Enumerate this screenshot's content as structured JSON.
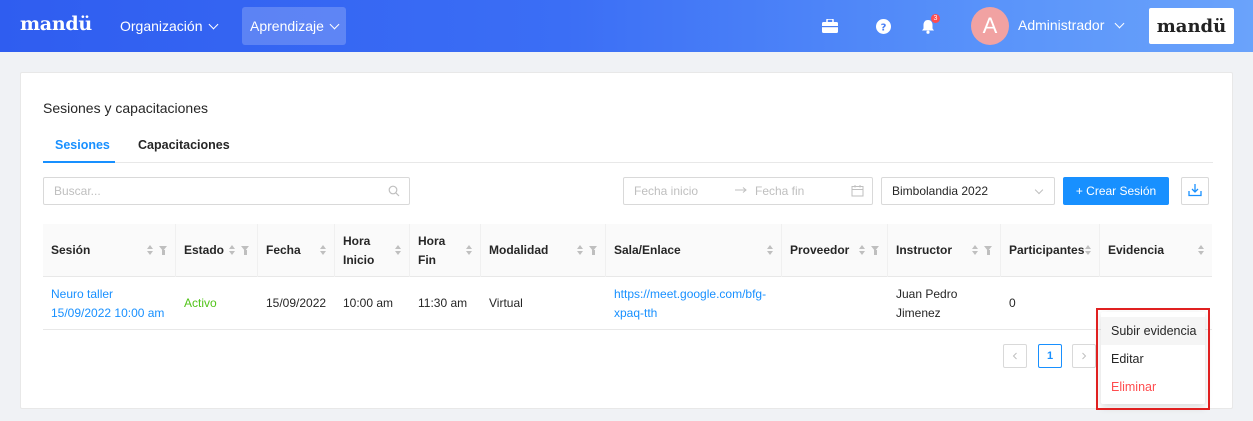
{
  "header": {
    "logo": "mandü",
    "nav": [
      {
        "label": "Organización"
      },
      {
        "label": "Aprendizaje"
      }
    ],
    "notification_count": "3",
    "avatar_letter": "A",
    "user_name": "Administrador",
    "brand": "mandü"
  },
  "page": {
    "title": "Sesiones y capacitaciones",
    "tabs": [
      {
        "label": "Sesiones"
      },
      {
        "label": "Capacitaciones"
      }
    ]
  },
  "filters": {
    "search_placeholder": "Buscar...",
    "date_start_placeholder": "Fecha inicio",
    "date_end_placeholder": "Fecha fin",
    "select_value": "Bimbolandia 2022",
    "create_button": "+ Crear Sesión"
  },
  "table": {
    "columns": [
      {
        "label": "Sesión"
      },
      {
        "label": "Estado"
      },
      {
        "label": "Fecha"
      },
      {
        "label_line1": "Hora",
        "label_line2": "Inicio"
      },
      {
        "label_line1": "Hora",
        "label_line2": "Fin"
      },
      {
        "label": "Modalidad"
      },
      {
        "label": "Sala/Enlace"
      },
      {
        "label": "Proveedor"
      },
      {
        "label": "Instructor"
      },
      {
        "label": "Participantes"
      },
      {
        "label": "Evidencia"
      }
    ],
    "rows": [
      {
        "session_line1": "Neuro taller",
        "session_line2": "15/09/2022 10:00 am",
        "status": "Activo",
        "date": "15/09/2022",
        "start": "10:00 am",
        "end": "11:30 am",
        "mode": "Virtual",
        "link_line1": "https://meet.google.com/bfg-",
        "link_line2": "xpaq-tth",
        "provider": "",
        "instructor_line1": "Juan Pedro",
        "instructor_line2": "Jimenez",
        "participants": "0",
        "evidence": "",
        "more": "..."
      }
    ]
  },
  "pagination": {
    "current": "1"
  },
  "menu": {
    "items": [
      {
        "label": "Subir evidencia"
      },
      {
        "label": "Editar"
      },
      {
        "label": "Eliminar"
      }
    ]
  },
  "colors": {
    "primary": "#1890ff",
    "danger": "#ff4d4f",
    "success": "#52c41a",
    "highlight": "#e02020"
  },
  "icons": [
    "briefcase-icon",
    "help-icon",
    "bell-icon",
    "search-icon",
    "calendar-icon",
    "download-icon",
    "sort-icon",
    "filter-icon"
  ]
}
